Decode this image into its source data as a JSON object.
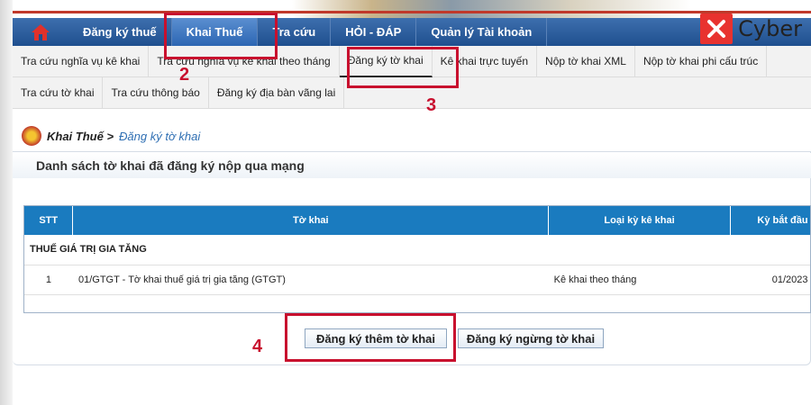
{
  "nav": {
    "items": [
      "Đăng ký thuế",
      "Khai Thuế",
      "Tra cứu",
      "HỎI - ĐÁP",
      "Quản lý Tài khoản"
    ],
    "active": "Khai Thuế"
  },
  "brand": {
    "name": "Cyber",
    "logo": "cyber-x-logo"
  },
  "subnav": {
    "row1": [
      "Tra cứu nghĩa vụ kê khai",
      "Tra cứu nghĩa vụ kê khai theo tháng",
      "Đăng ký tờ khai",
      "Kê khai trực tuyến",
      "Nộp tờ khai XML",
      "Nộp tờ khai phi cấu trúc"
    ],
    "row2": [
      "Tra cứu tờ khai",
      "Tra cứu thông báo",
      "Đăng ký địa bàn vãng lai"
    ],
    "active": "Đăng ký tờ khai"
  },
  "breadcrumb": {
    "parent": "Khai Thuế >",
    "current": "Đăng ký tờ khai"
  },
  "panel": {
    "title": "Danh sách tờ khai đã đăng ký nộp qua mạng"
  },
  "table": {
    "headers": [
      "STT",
      "Tờ khai",
      "Loại kỳ kê khai",
      "Kỳ bắt đầu"
    ],
    "group": "THUẾ GIÁ TRỊ GIA TĂNG",
    "rows": [
      {
        "stt": "1",
        "to_khai": "01/GTGT - Tờ khai thuế giá trị gia tăng (GTGT)",
        "loai_ky": "Kê khai theo tháng",
        "ky_bat_dau": "01/2023"
      }
    ]
  },
  "buttons": {
    "register_more": "Đăng ký thêm tờ khai",
    "register_stop": "Đăng ký ngừng tờ khai"
  },
  "annotations": {
    "step2": "2",
    "step3": "3",
    "step4": "4"
  },
  "colors": {
    "nav": "#1f4f8f",
    "highlight": "#c8102e",
    "table_header": "#1a7bbf"
  }
}
